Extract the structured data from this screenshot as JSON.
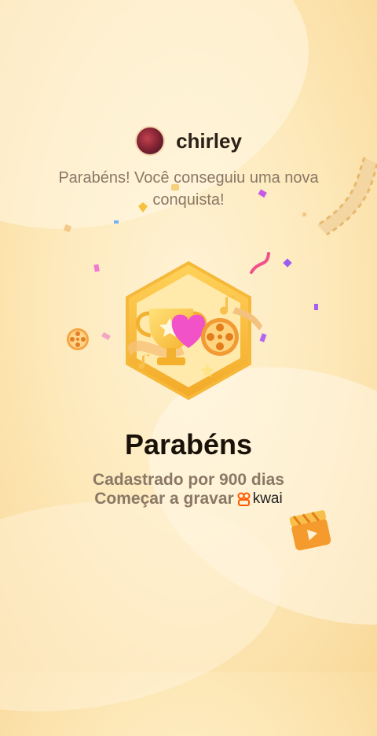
{
  "user": {
    "name": "chirley"
  },
  "message": "Parabéns! Você conseguiu uma nova conquista!",
  "achievement": {
    "title": "Parabéns",
    "subtitle": "Cadastrado por 900 dias",
    "cta": "Começar a gravar"
  },
  "brand": {
    "name": "kwai",
    "color": "#ff5a00"
  },
  "icons": [
    "trophy-icon",
    "heart-icon",
    "film-reel-icon",
    "film-strip-icon",
    "clapperboard-icon",
    "music-note-icon",
    "star-icon"
  ],
  "colors": {
    "accent": "#f5a623",
    "badge_gold": "#f7c548",
    "heart": "#f252c8"
  }
}
